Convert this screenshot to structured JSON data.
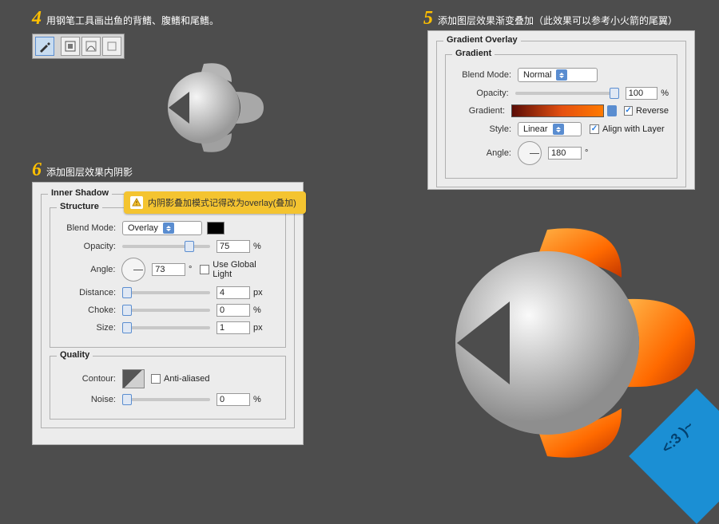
{
  "steps": {
    "s4": {
      "num": "4",
      "text": "用钢笔工具画出鱼的背鳍、腹鳍和尾鳍。"
    },
    "s5": {
      "num": "5",
      "text": "添加图层效果渐变叠加（此效果可以参考小火箭的尾翼）"
    },
    "s6": {
      "num": "6",
      "text": "添加图层效果内阴影"
    }
  },
  "callout": {
    "text": "内阴影叠加模式记得改为overlay(叠加)"
  },
  "innerShadow": {
    "title": "Inner Shadow",
    "structure": "Structure",
    "blendModeLabel": "Blend Mode:",
    "blendMode": "Overlay",
    "opacityLabel": "Opacity:",
    "opacity": "75",
    "opacityUnit": "%",
    "angleLabel": "Angle:",
    "angle": "73",
    "angleUnit": "°",
    "useGlobal": "Use Global Light",
    "distanceLabel": "Distance:",
    "distance": "4",
    "chokeLabel": "Choke:",
    "choke": "0",
    "sizeLabel": "Size:",
    "size": "1",
    "pxUnit": "px",
    "pctUnit": "%",
    "quality": "Quality",
    "contourLabel": "Contour:",
    "antiAliased": "Anti-aliased",
    "noiseLabel": "Noise:",
    "noise": "0"
  },
  "gradientOverlay": {
    "title": "Gradient Overlay",
    "gradient": "Gradient",
    "blendModeLabel": "Blend Mode:",
    "blendMode": "Normal",
    "opacityLabel": "Opacity:",
    "opacity": "100",
    "opacityUnit": "%",
    "gradientLabel": "Gradient:",
    "reverse": "Reverse",
    "styleLabel": "Style:",
    "style": "Linear",
    "alignLayer": "Align with Layer",
    "angleLabel": "Angle:",
    "angle": "180",
    "angleUnit": "°"
  },
  "corner": {
    "text": "<:3 )~"
  }
}
